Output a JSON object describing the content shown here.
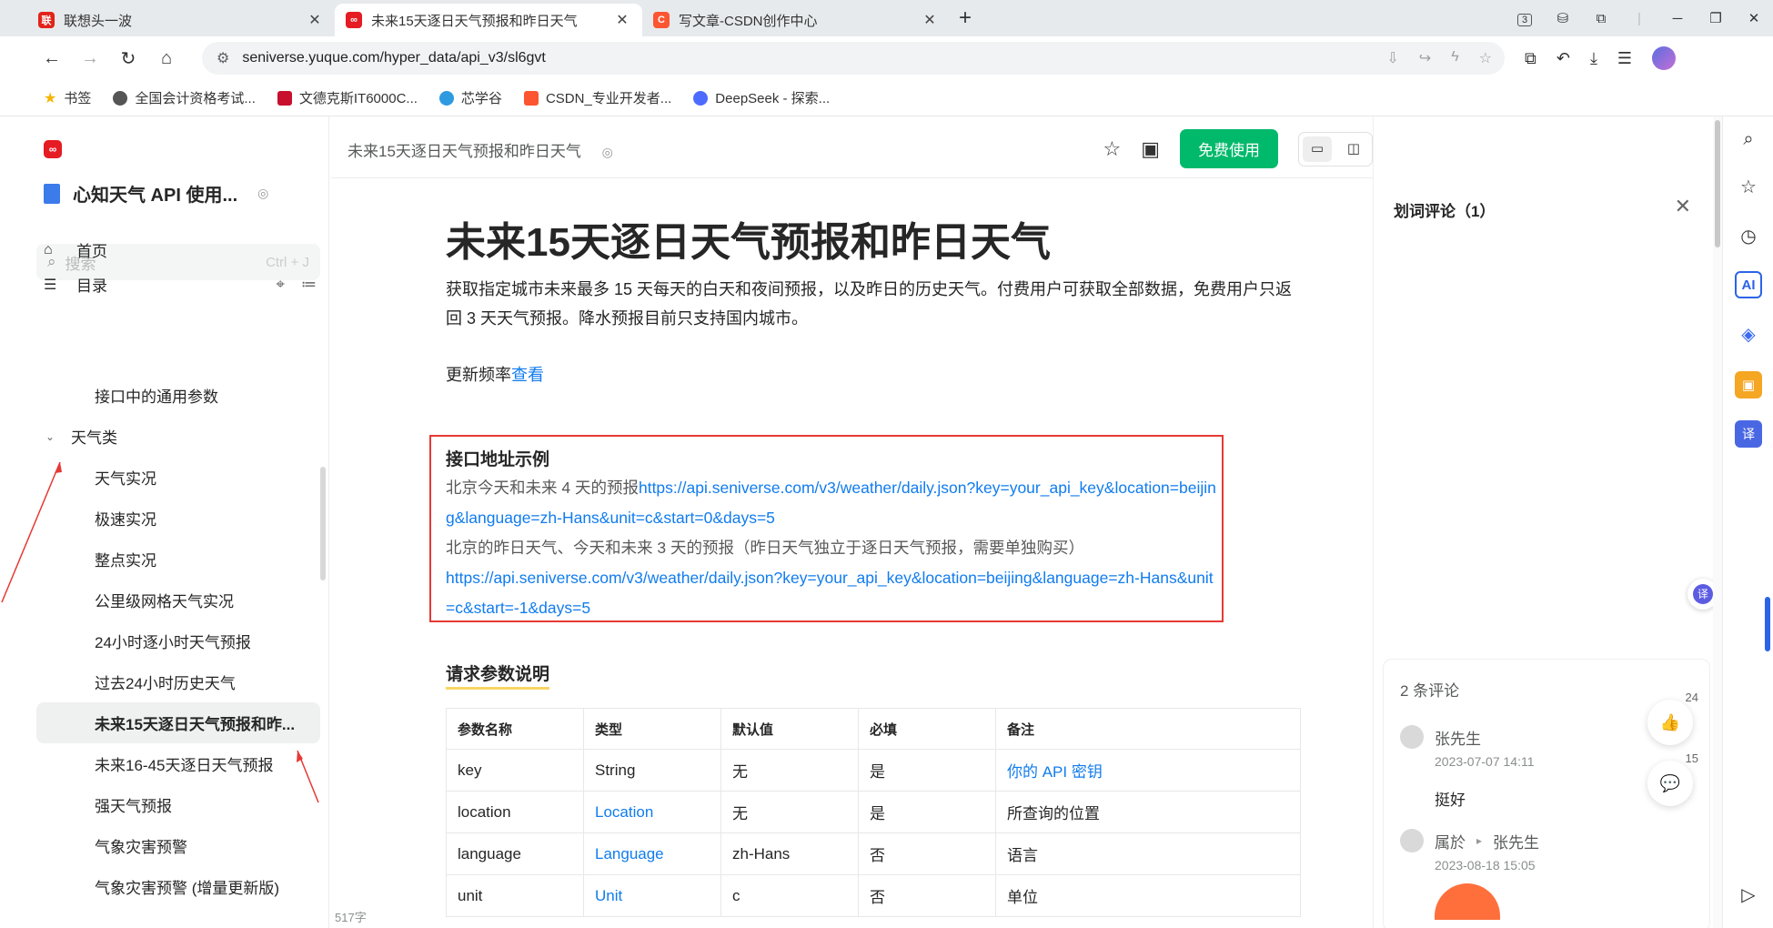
{
  "browser": {
    "tabs": [
      {
        "title": "联想头一波",
        "icon": "lenovo-icon",
        "color": "#e2231a",
        "active": false
      },
      {
        "title": "未来15天逐日天气预报和昨日天气",
        "icon": "yuque-icon",
        "color": "#e51c23",
        "active": true
      },
      {
        "title": "写文章-CSDN创作中心",
        "icon": "csdn-icon",
        "color": "#fc5531",
        "active": false
      }
    ],
    "tab_count_badge": "3",
    "url": "seniverse.yuque.com/hyper_data/api_v3/sl6gvt",
    "bookmarks": [
      {
        "label": "书签",
        "icon": "star-icon",
        "color": "#f5b400"
      },
      {
        "label": "全国会计资格考试...",
        "icon": "accounting-icon",
        "color": "#555555"
      },
      {
        "label": "文德克斯IT6000C...",
        "icon": "wdks-icon",
        "color": "#c8102e"
      },
      {
        "label": "芯学谷",
        "icon": "xinxuegu-icon",
        "color": "#2e9ae0"
      },
      {
        "label": "CSDN_专业开发者...",
        "icon": "csdn-icon",
        "color": "#fc5531"
      },
      {
        "label": "DeepSeek - 探索...",
        "icon": "deepseek-icon",
        "color": "#4d6bfe"
      }
    ]
  },
  "sidebar": {
    "book_title": "心知天气 API 使用...",
    "search_placeholder": "搜索",
    "search_hint": "Ctrl + J",
    "home": "首页",
    "toc": "目录",
    "items": [
      {
        "label": "接口中的通用参数",
        "type": "item"
      },
      {
        "label": "天气类",
        "type": "group"
      },
      {
        "label": "天气实况",
        "type": "item"
      },
      {
        "label": "极速实况",
        "type": "item"
      },
      {
        "label": "整点实况",
        "type": "item"
      },
      {
        "label": "公里级网格天气实况",
        "type": "item"
      },
      {
        "label": "24小时逐小时天气预报",
        "type": "item"
      },
      {
        "label": "过去24小时历史天气",
        "type": "item"
      },
      {
        "label": "未来15天逐日天气预报和昨...",
        "type": "selected"
      },
      {
        "label": "未来16-45天逐日天气预报",
        "type": "item"
      },
      {
        "label": "强天气预报",
        "type": "item"
      },
      {
        "label": "气象灾害预警",
        "type": "item"
      },
      {
        "label": "气象灾害预警 (增量更新版)",
        "type": "item"
      }
    ]
  },
  "main": {
    "breadcrumb": "未来15天逐日天气预报和昨日天气",
    "free_button": "免费使用",
    "title": "未来15天逐日天气预报和昨日天气",
    "lead": "获取指定城市未来最多 15 天每天的白天和夜间预报，以及昨日的历史天气。付费用户可获取全部数据，免费用户只返回 3 天天气预报。降水预报目前只支持国内城市。",
    "freq_label": "更新频率",
    "freq_link": "查看",
    "example_heading": "接口地址示例",
    "ex1_text": "北京今天和未来 4 天的预报",
    "ex1_url": "https://api.seniverse.com/v3/weather/daily.json?key=your_api_key&location=beijing&language=zh-Hans&unit=c&start=0&days=5",
    "ex2_text": "北京的昨日天气、今天和未来 3 天的预报（昨日天气独立于逐日天气预报，需要单独购买）",
    "ex2_url": "https://api.seniverse.com/v3/weather/daily.json?key=your_api_key&location=beijing&language=zh-Hans&unit=c&start=-1&days=5",
    "params_heading": "请求参数说明",
    "table": {
      "headers": [
        "参数名称",
        "类型",
        "默认值",
        "必填",
        "备注"
      ],
      "rows": [
        [
          "key",
          "String",
          "无",
          "是",
          "你的 API 密钥"
        ],
        [
          "location",
          "Location",
          "无",
          "是",
          "所查询的位置"
        ],
        [
          "language",
          "Language",
          "zh-Hans",
          "否",
          "语言"
        ],
        [
          "unit",
          "Unit",
          "c",
          "否",
          "单位"
        ]
      ]
    },
    "word_count": "517字"
  },
  "comments": {
    "title": "划词评论（1）",
    "count_text": "2 条评论",
    "like_count": "24",
    "reply_count": "15",
    "c1": {
      "author": "张先生",
      "date": "2023-07-07 14:11",
      "text": "挺好"
    },
    "c2": {
      "author": "属於",
      "reply_to": "张先生",
      "date": "2023-08-18 15:05"
    }
  },
  "edge_tools": [
    "search-icon",
    "favorite-icon",
    "history-icon",
    "copilot-icon",
    "games-icon",
    "toolbox-icon",
    "translate-icon"
  ],
  "colors": {
    "accent_green": "#00b96b",
    "link_blue": "#117cee",
    "annotation_red": "#e53935"
  }
}
